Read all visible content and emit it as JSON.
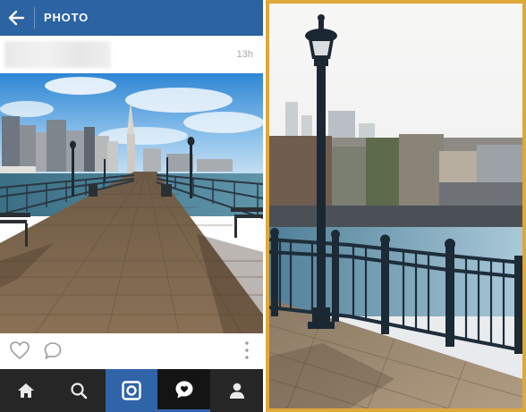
{
  "app_bar": {
    "title": "PHOTO",
    "back_icon": "arrow-left-icon",
    "background": "#2b63a3"
  },
  "post": {
    "timestamp": "13h",
    "username_blurred": true
  },
  "actions": {
    "like_icon": "heart-outline-icon",
    "comment_icon": "speech-bubble-icon",
    "more_icon": "vertical-dots-icon"
  },
  "tab_bar": {
    "items": [
      {
        "icon": "home-icon",
        "selected": false
      },
      {
        "icon": "search-icon",
        "selected": false
      },
      {
        "icon": "camera-icon",
        "selected": false,
        "color": "#2f64a8"
      },
      {
        "icon": "activity-bubble-icon",
        "selected": true
      },
      {
        "icon": "profile-icon",
        "selected": false
      }
    ]
  },
  "zoom_panel": {
    "border_color": "#e0a73a",
    "subject": "lamp-post-and-railing"
  }
}
